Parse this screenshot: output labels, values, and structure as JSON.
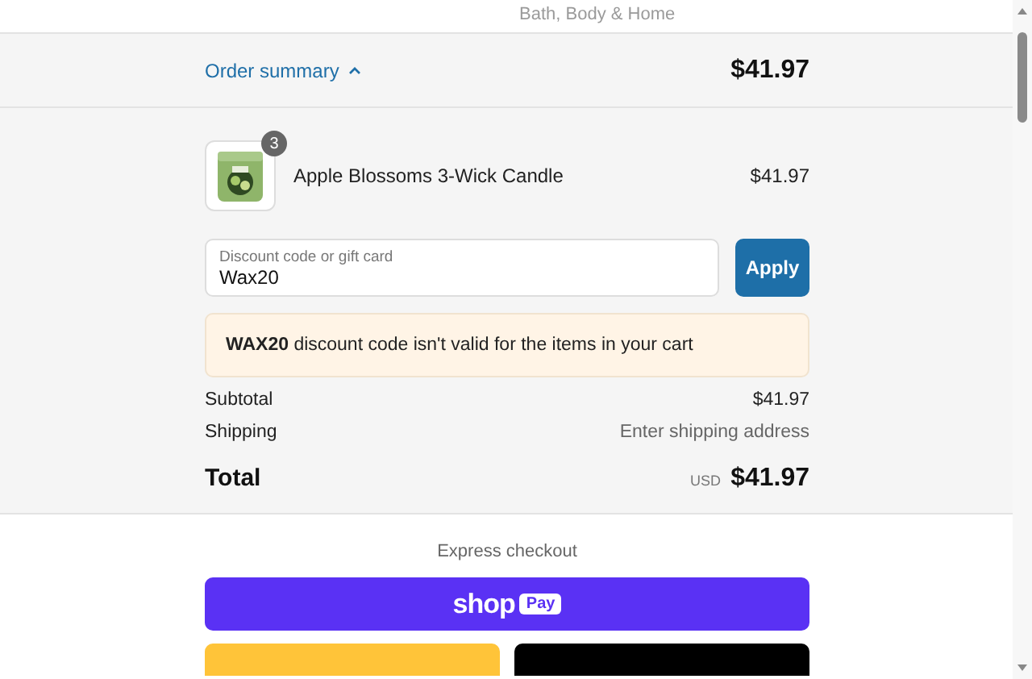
{
  "header": {
    "tagline": "Bath, Body & Home"
  },
  "summary": {
    "toggle_label": "Order summary",
    "expanded": true,
    "total": "$41.97"
  },
  "items": [
    {
      "name": "Apple Blossoms 3-Wick Candle",
      "quantity": "3",
      "price": "$41.97"
    }
  ],
  "discount": {
    "placeholder": "Discount code or gift card",
    "value": "Wax20",
    "button": "Apply"
  },
  "alert": {
    "message": "**WAX20** discount code isn't valid for the items in your cart"
  },
  "lines": [
    {
      "label": "Subtotal",
      "value": "$41.97",
      "kind": "amount"
    },
    {
      "label": "Shipping",
      "value": "Enter shipping address",
      "kind": "hint"
    }
  ],
  "total": {
    "label": "Total",
    "currency": "USD",
    "amount": "$41.97"
  },
  "express": {
    "title": "Express checkout",
    "shop_word": "shop",
    "pay_word": "Pay"
  }
}
